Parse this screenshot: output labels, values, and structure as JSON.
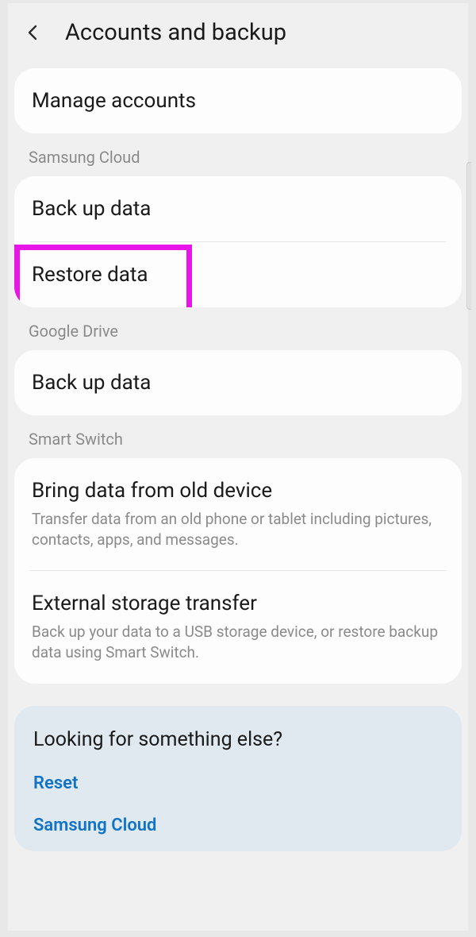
{
  "header": {
    "title": "Accounts and backup"
  },
  "top": {
    "manage_accounts": "Manage accounts"
  },
  "samsung_cloud": {
    "header": "Samsung Cloud",
    "backup": "Back up data",
    "restore": "Restore data"
  },
  "google_drive": {
    "header": "Google Drive",
    "backup": "Back up data"
  },
  "smart_switch": {
    "header": "Smart Switch",
    "bring_title": "Bring data from old device",
    "bring_sub": "Transfer data from an old phone or tablet including pictures, contacts, apps, and messages.",
    "external_title": "External storage transfer",
    "external_sub": "Back up your data to a USB storage device, or restore backup data using Smart Switch."
  },
  "footer": {
    "title": "Looking for something else?",
    "link_reset": "Reset",
    "link_samsung_cloud": "Samsung Cloud"
  },
  "annotation": {
    "highlight_target": "restore-data"
  }
}
